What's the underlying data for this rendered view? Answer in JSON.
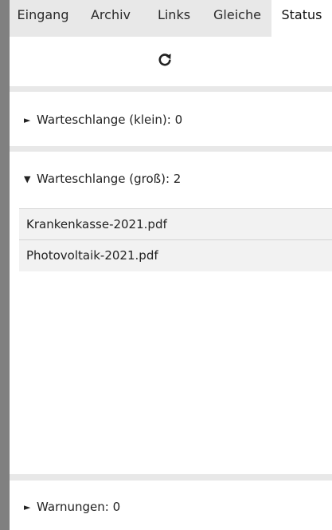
{
  "tabs": [
    "Eingang",
    "Archiv",
    "Links",
    "Gleiche",
    "Status"
  ],
  "active_tab": "Status",
  "refresh": {
    "icon": "refresh-icon",
    "glyph": "⟳"
  },
  "queue_small": {
    "arrow": "►",
    "label": "Warteschlange (klein): 0"
  },
  "queue_large": {
    "arrow": "▼",
    "label": "Warteschlange (groß): 2",
    "files": [
      "Krankenkasse-2021.pdf",
      "Photovoltaik-2021.pdf"
    ]
  },
  "warnings": {
    "arrow": "►",
    "label": "Warnungen: 0"
  }
}
